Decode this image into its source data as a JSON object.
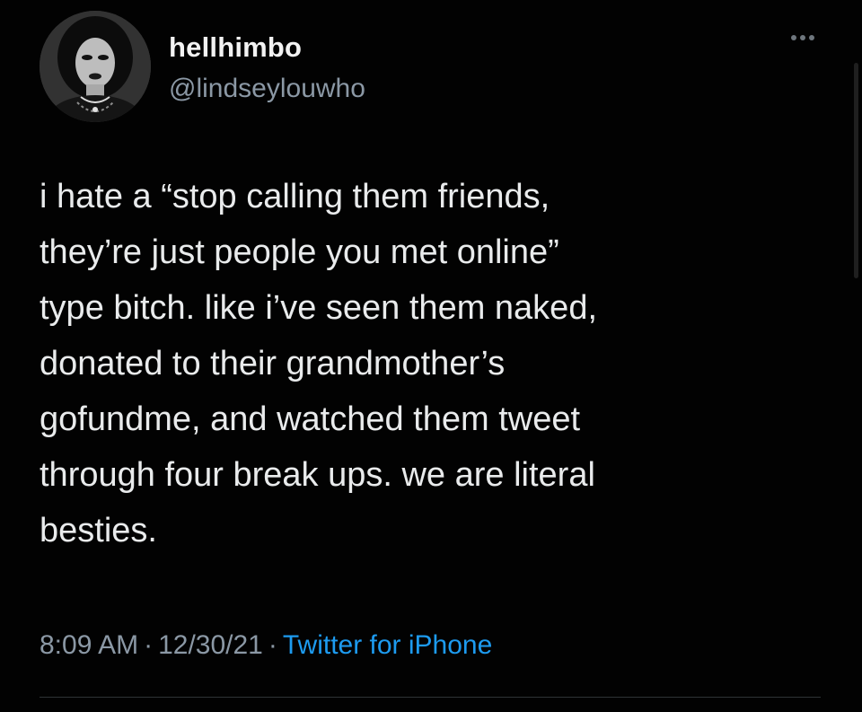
{
  "tweet": {
    "author": {
      "display_name": "hellhimbo",
      "handle": "@lindseylouwho",
      "avatar_icon": "profile-photo"
    },
    "more_icon": "more-horizontal-icon",
    "text": "i hate a “stop calling them friends,\nthey’re just people you met online”\ntype bitch. like i’ve seen them naked,\ndonated to their grandmother’s\ngofundme, and watched them tweet\nthrough four break ups. we are literal\nbesties.",
    "time": "8:09 AM",
    "separator": "·",
    "date": "12/30/21",
    "source": "Twitter for iPhone"
  },
  "colors": {
    "background": "#020202",
    "text": "#e9ebec",
    "secondary": "#8b98a5",
    "link": "#1d9bf0",
    "divider": "#2f3336"
  }
}
